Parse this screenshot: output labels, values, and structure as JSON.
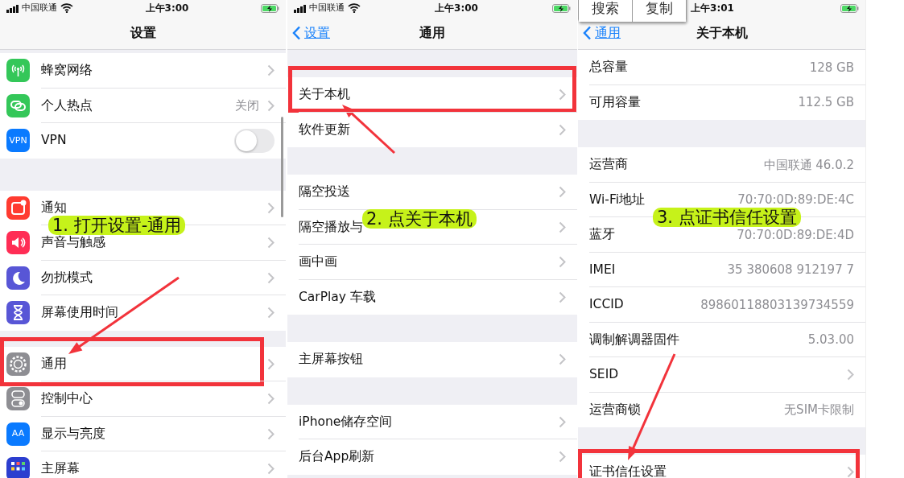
{
  "panels": [
    {
      "status_bar": {
        "carrier": "中国联通",
        "time": "上午3:00"
      },
      "nav": {
        "title": "设置"
      },
      "callout": {
        "text": "1. 打开设置-通用"
      },
      "groups": [
        [
          {
            "label": "蜂窝网络",
            "kind": "chevron",
            "color": "#34c759"
          },
          {
            "label": "个人热点",
            "value": "关闭",
            "kind": "chevron",
            "color": "#34c759"
          },
          {
            "label": "VPN",
            "kind": "toggle",
            "on": false,
            "color": "#0a7aff",
            "icon_text": "VPN"
          }
        ],
        [
          {
            "label": "通知",
            "kind": "chevron",
            "color": "#ff3b30"
          },
          {
            "label": "声音与触感",
            "kind": "chevron",
            "color": "#ff2d55"
          },
          {
            "label": "勿扰模式",
            "kind": "chevron",
            "color": "#5856d6"
          },
          {
            "label": "屏幕使用时间",
            "kind": "chevron",
            "color": "#5856d6"
          }
        ],
        [
          {
            "label": "通用",
            "kind": "chevron",
            "color": "#8e8e93",
            "boxed": true
          },
          {
            "label": "控制中心",
            "kind": "chevron",
            "color": "#8e8e93"
          },
          {
            "label": "显示与亮度",
            "kind": "chevron",
            "color": "#0a7aff",
            "icon_text": "AA"
          },
          {
            "label": "主屏幕",
            "kind": "chevron",
            "color": "#2c3ecf"
          }
        ]
      ]
    },
    {
      "status_bar": {
        "carrier": "中国联通",
        "time": "上午3:00"
      },
      "nav": {
        "back": "设置",
        "title": "通用"
      },
      "callout": {
        "text": "2. 点关于本机"
      },
      "groups": [
        [
          {
            "label": "关于本机",
            "kind": "chevron",
            "boxed": true
          },
          {
            "label": "软件更新",
            "kind": "chevron"
          }
        ],
        [
          {
            "label": "隔空投送",
            "kind": "chevron"
          },
          {
            "label": "隔空播放与",
            "kind": "chevron"
          },
          {
            "label": "画中画",
            "kind": "chevron"
          },
          {
            "label": "CarPlay 车载",
            "kind": "chevron"
          }
        ],
        [
          {
            "label": "主屏幕按钮",
            "kind": "chevron"
          }
        ],
        [
          {
            "label": "iPhone储存空间",
            "kind": "chevron"
          },
          {
            "label": "后台App刷新",
            "kind": "chevron"
          }
        ]
      ]
    },
    {
      "status_bar": {
        "time": "上午3:01"
      },
      "nav": {
        "back": "通用",
        "title": "关于本机"
      },
      "callout": {
        "text": "3. 点证书信任设置"
      },
      "edit_menu": [
        "搜索",
        "复制"
      ],
      "groups": [
        [
          {
            "label": "总容量",
            "value": "128 GB",
            "kind": "plain"
          },
          {
            "label": "可用容量",
            "value": "112.5 GB",
            "kind": "plain"
          }
        ],
        [
          {
            "label": "运营商",
            "value": "中国联通 46.0.2",
            "kind": "plain"
          },
          {
            "label": "Wi-Fi地址",
            "value": "70:70:0D:89:DE:4C",
            "kind": "plain"
          },
          {
            "label": "蓝牙",
            "value": "70:70:0D:89:DE:4D",
            "kind": "plain"
          },
          {
            "label": "IMEI",
            "value": "35 380608 912197 7",
            "kind": "plain"
          },
          {
            "label": "ICCID",
            "value": "89860118803139734559",
            "kind": "plain"
          },
          {
            "label": "调制解调器固件",
            "value": "5.03.00",
            "kind": "plain"
          },
          {
            "label": "SEID",
            "kind": "chevron"
          },
          {
            "label": "运营商锁",
            "value": "无SIM卡限制",
            "kind": "plain"
          }
        ],
        [
          {
            "label": "证书信任设置",
            "kind": "chevron",
            "boxed": true
          }
        ]
      ]
    }
  ]
}
